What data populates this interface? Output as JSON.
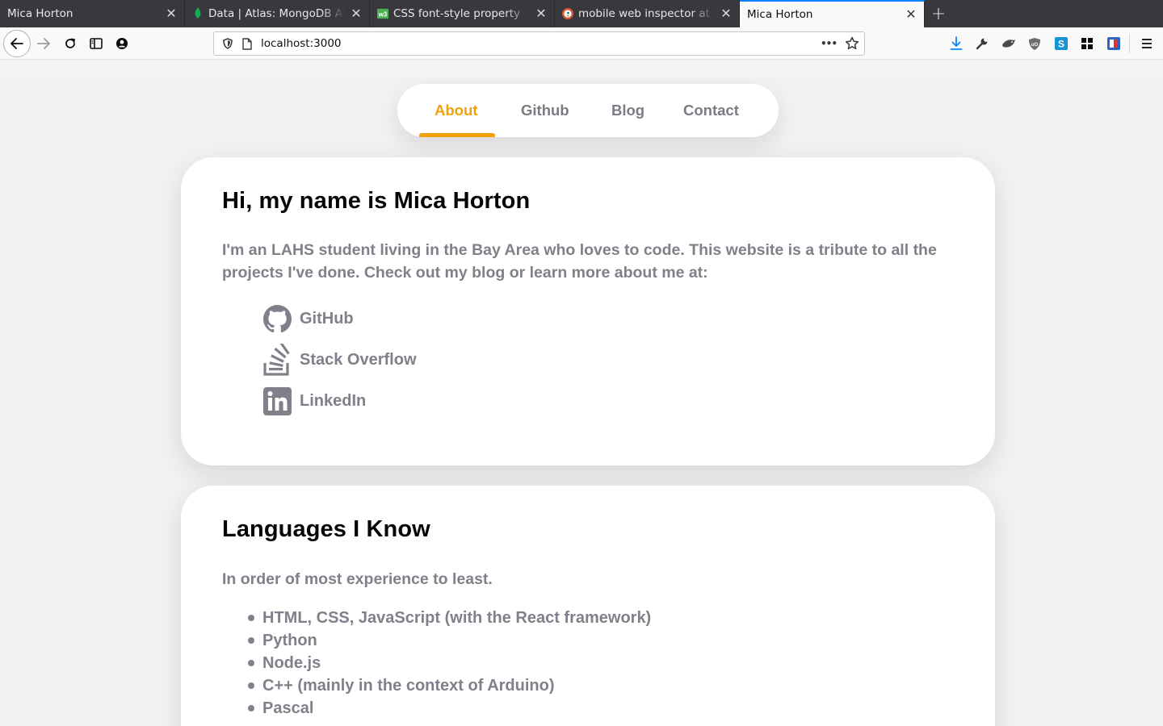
{
  "browser": {
    "tabs": [
      {
        "title": "Mica Horton",
        "favicon": "none",
        "active": false
      },
      {
        "title": "Data | Atlas: MongoDB Atlas",
        "favicon": "mongodb-leaf-icon",
        "active": false
      },
      {
        "title": "CSS font-style property",
        "favicon": "w3schools-icon",
        "active": false
      },
      {
        "title": "mobile web inspector at DuckDuckGo",
        "favicon": "duckduckgo-icon",
        "active": false
      },
      {
        "title": "Mica Horton",
        "favicon": "none",
        "active": true
      }
    ],
    "close_glyph": "✕",
    "new_tab_glyph": "+",
    "url": "localhost:3000",
    "page_actions_glyph": "•••"
  },
  "site": {
    "nav": {
      "items": [
        "About",
        "Github",
        "Blog",
        "Contact"
      ],
      "active": "About",
      "accent": "#f2a007"
    },
    "about": {
      "heading": "Hi, my name is Mica Horton",
      "intro": "I'm an LAHS student living in the Bay Area who loves to code. This website is a tribute to all the projects I've done. Check out my blog or learn more about me at:",
      "links": [
        {
          "label": "GitHub",
          "icon": "github-icon"
        },
        {
          "label": "Stack Overflow",
          "icon": "stackoverflow-icon"
        },
        {
          "label": "LinkedIn",
          "icon": "linkedin-icon"
        }
      ]
    },
    "languages": {
      "heading": "Languages I Know",
      "subtitle": "In order of most experience to least.",
      "items": [
        "HTML, CSS, JavaScript (with the React framework)",
        "Python",
        "Node.js",
        "C++ (mainly in the context of Arduino)",
        "Pascal"
      ]
    }
  }
}
